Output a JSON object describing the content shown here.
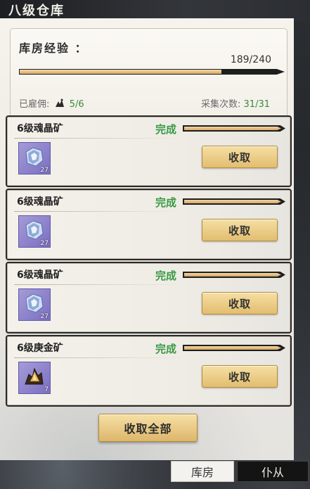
{
  "window": {
    "title": "八级仓库"
  },
  "warehouse": {
    "exp_label": "库房经验 ：",
    "exp_count": "189/240",
    "exp_progress": 0.7875,
    "hired_label": "已雇佣:",
    "hired_value": "5/6",
    "collect_label": "采集次数:",
    "collect_value": "31/31"
  },
  "tasks": [
    {
      "name": "6级魂晶矿",
      "status": "完成",
      "progress": 1.0,
      "item_icon": "blue-crystal-icon",
      "qty": "27",
      "button": "收取"
    },
    {
      "name": "6级魂晶矿",
      "status": "完成",
      "progress": 1.0,
      "item_icon": "blue-crystal-icon",
      "qty": "27",
      "button": "收取"
    },
    {
      "name": "6级魂晶矿",
      "status": "完成",
      "progress": 1.0,
      "item_icon": "blue-crystal-icon",
      "qty": "27",
      "button": "收取"
    },
    {
      "name": "6级庚金矿",
      "status": "完成",
      "progress": 1.0,
      "item_icon": "gold-ore-icon",
      "qty": "7",
      "button": "收取"
    }
  ],
  "collect_all_label": "收取全部",
  "tabs": {
    "warehouse": "库房",
    "servant": "仆从"
  },
  "colors": {
    "status_green": "#3a9a45",
    "button_gold": "#e2bd6f",
    "item_purple": "#8a7fcf"
  }
}
